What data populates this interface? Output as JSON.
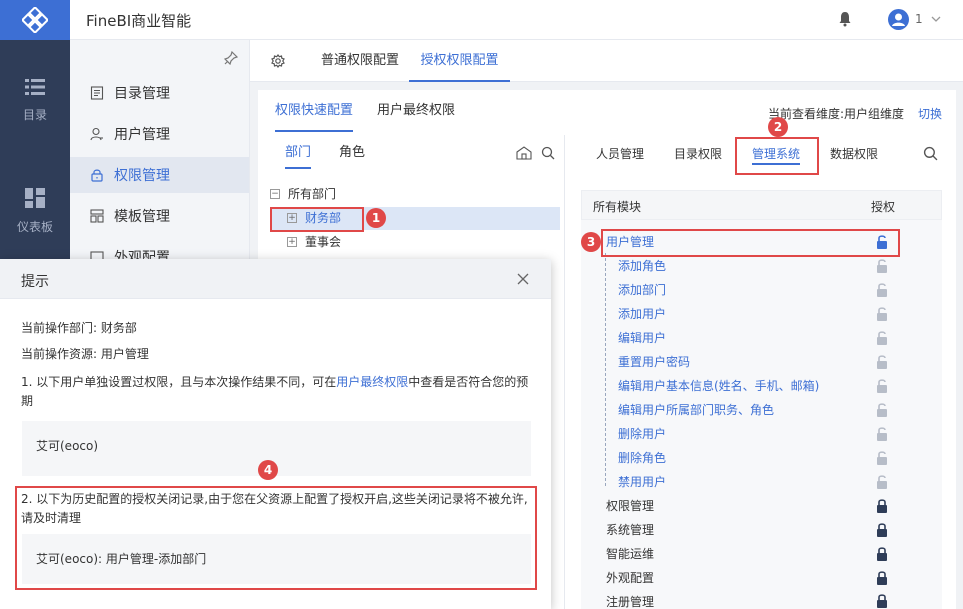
{
  "app": {
    "title": "FineBI商业智能",
    "user_count": "1",
    "brand_color": "#3d6fd4"
  },
  "leftnav": [
    {
      "label": "目录",
      "icon": "list-icon"
    },
    {
      "label": "仪表板",
      "icon": "dashboard-icon"
    }
  ],
  "sidebar": {
    "items": [
      {
        "label": "目录管理",
        "icon": "catalog-icon"
      },
      {
        "label": "用户管理",
        "icon": "user-icon"
      },
      {
        "label": "权限管理",
        "icon": "lock-icon",
        "active": true
      },
      {
        "label": "模板管理",
        "icon": "template-icon"
      },
      {
        "label": "外观配置",
        "icon": "appearance-icon"
      }
    ]
  },
  "tabs": {
    "normal": "普通权限配置",
    "grant": "授权权限配置"
  },
  "subtabs": {
    "quick": "权限快速配置",
    "final": "用户最终权限"
  },
  "dimension": {
    "label": "当前查看维度:用户组维度",
    "switch": "切换"
  },
  "leftpanel": {
    "tabs": {
      "dept": "部门",
      "role": "角色"
    },
    "tree": {
      "root": "所有部门",
      "child1": "财务部",
      "child2": "董事会"
    }
  },
  "rightpanel": {
    "tabs": {
      "people": "人员管理",
      "catalog": "目录权限",
      "system": "管理系统",
      "data": "数据权限"
    },
    "header": {
      "modules": "所有模块",
      "grant": "授权"
    },
    "rows": [
      "用户管理",
      "添加角色",
      "添加部门",
      "添加用户",
      "编辑用户",
      "重置用户密码",
      "编辑用户基本信息(姓名、手机、邮箱)",
      "编辑用户所属部门职务、角色",
      "删除用户",
      "删除角色",
      "禁用用户",
      "权限管理",
      "系统管理",
      "智能运维",
      "外观配置",
      "注册管理"
    ]
  },
  "markers": {
    "m1": "1",
    "m2": "2",
    "m3": "3",
    "m4": "4"
  },
  "modal": {
    "title": "提示",
    "line1": "当前操作部门: 财务部",
    "line2": "当前操作资源: 用户管理",
    "line3_a": "1. 以下用户单独设置过权限，且与本次操作结果不同，可在",
    "line3_link": "用户最终权限",
    "line3_b": "中查看是否符合您的预",
    "line3_c": "期",
    "box1": "艾可(eoco)",
    "line4_a": "2. 以下为历史配置的授权关闭记录,由于您在父资源上配置了授权开启,这些关闭记录将不被允许,",
    "line4_b": "请及时清理",
    "box2": "艾可(eoco): 用户管理-添加部门"
  }
}
